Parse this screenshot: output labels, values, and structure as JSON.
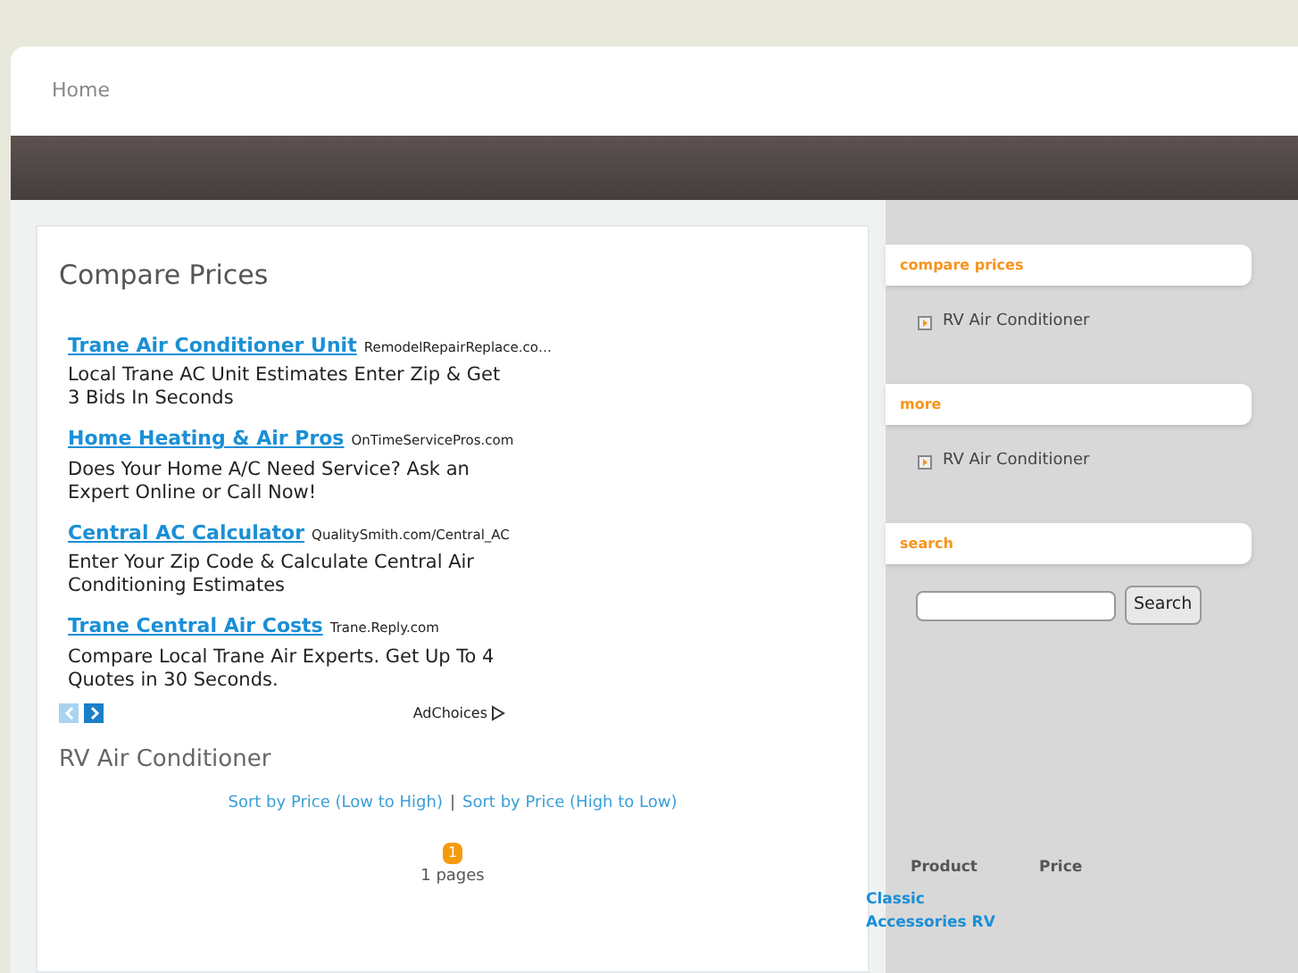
{
  "nav": {
    "items": [
      {
        "label": "Home",
        "selected": false
      }
    ]
  },
  "main": {
    "title": "Compare Prices",
    "ads": [
      {
        "headline": "Trane Air Conditioner Unit",
        "domain": "RemodelRepairReplace.co…",
        "text": "Local Trane AC Unit Estimates Enter Zip & Get 3 Bids In Seconds"
      },
      {
        "headline": "Home Heating & Air Pros",
        "domain": "OnTimeServicePros.com",
        "text": "Does Your Home A/C Need Service? Ask an Expert Online or Call Now!"
      },
      {
        "headline": "Central AC Calculator",
        "domain": "QualitySmith.com/Central_AC",
        "text": "Enter Your Zip Code & Calculate Central Air Conditioning Estimates"
      },
      {
        "headline": "Trane Central Air Costs",
        "domain": "Trane.Reply.com",
        "text": "Compare Local Trane Air Experts. Get Up To 4 Quotes in 30 Seconds."
      }
    ],
    "prev_disabled": true,
    "adchoices": "AdChoices",
    "section_title": "RV Air Conditioner",
    "sort_links": [
      "Sort by Price (Low to High)",
      "Sort by Price (High to Low)"
    ],
    "separator": "|",
    "pages": [
      {
        "label": "1",
        "selected": true
      }
    ],
    "pages_text": "1 pages"
  },
  "sidebar": {
    "sections": [
      {
        "title": "compare prices",
        "items": [
          "RV Air Conditioner"
        ]
      },
      {
        "title": "more",
        "items": [
          "RV Air Conditioner"
        ]
      },
      {
        "title": "search"
      }
    ],
    "search_button": "Search"
  },
  "table": {
    "columns": [
      "Product",
      "Price"
    ],
    "rows": [
      {
        "product": "Classic Accessories RV"
      }
    ]
  }
}
